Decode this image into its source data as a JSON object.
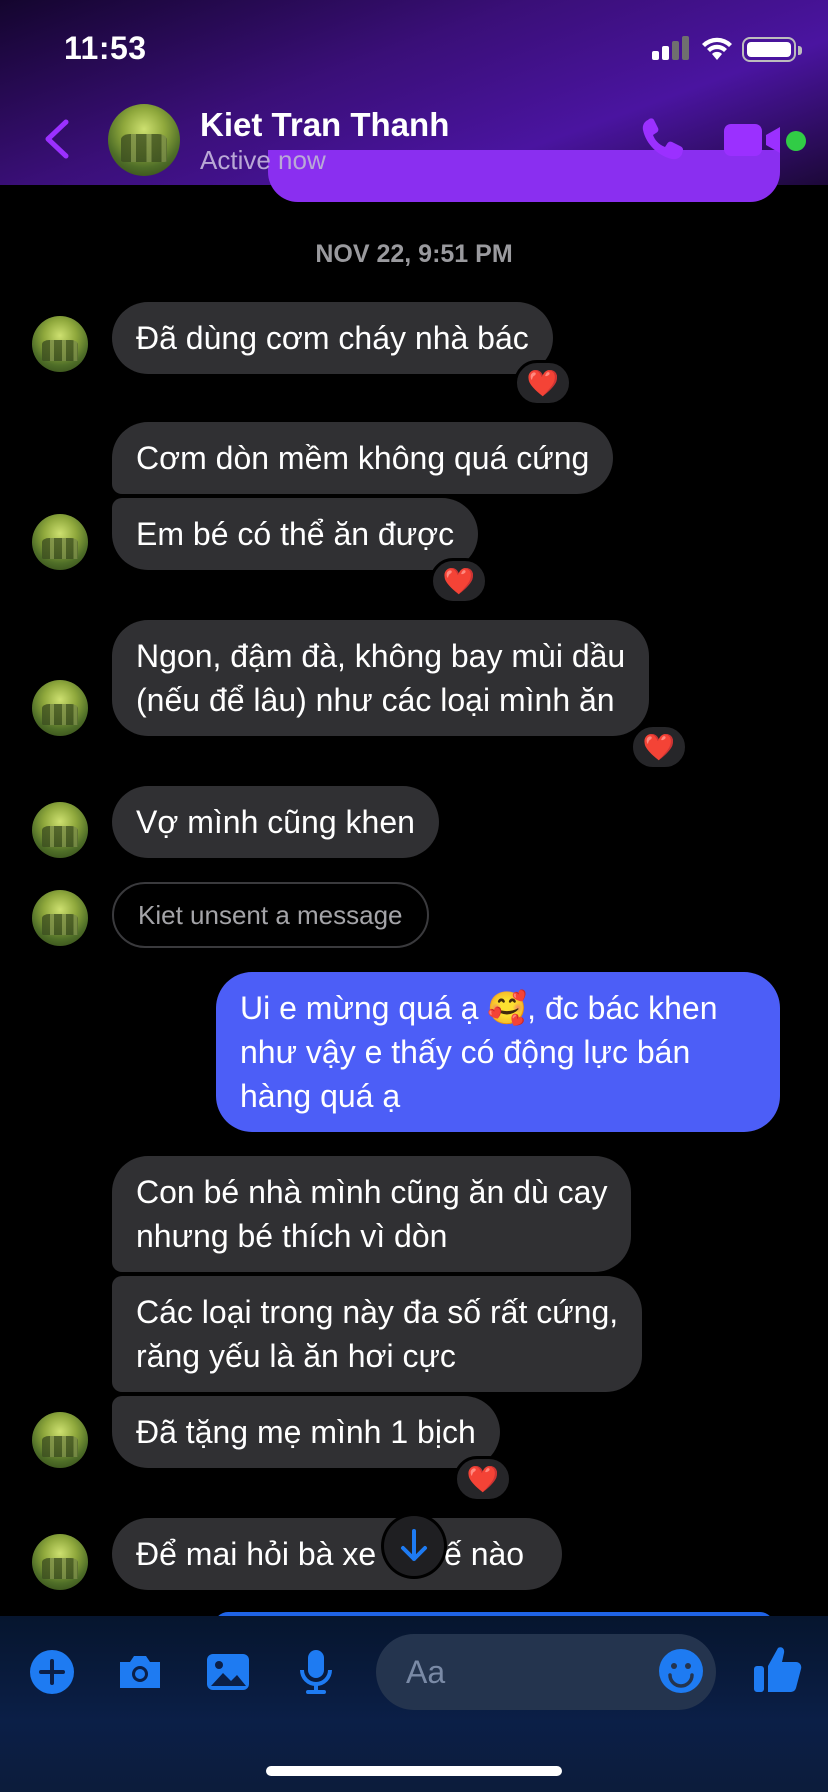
{
  "status_bar": {
    "time": "11:53"
  },
  "header": {
    "contact_name": "Kiet Tran Thanh",
    "presence": "Active now",
    "accent": "#9b30ff"
  },
  "thread": {
    "timestamp": "NOV 22, 9:51 PM",
    "messages": [
      {
        "from": "contact",
        "lines": [
          "Đã dùng cơm cháy nhà bác"
        ],
        "reaction": "❤️"
      },
      {
        "from": "contact",
        "lines": [
          "Cơm dòn mềm không quá cứng"
        ]
      },
      {
        "from": "contact",
        "lines": [
          "Em bé có thể ăn được"
        ],
        "reaction": "❤️"
      },
      {
        "from": "contact",
        "lines": [
          "Ngon, đậm đà, không bay mùi dầu",
          "(nếu để lâu) như các loại mình ăn"
        ],
        "reaction": "❤️"
      },
      {
        "from": "contact",
        "lines": [
          "Vợ mình cũng khen"
        ]
      },
      {
        "from": "contact",
        "unsent": "Kiet unsent a message"
      },
      {
        "from": "me",
        "lines": [
          "Ui e mừng quá ạ 🥰, đc bác khen",
          "như vậy e thấy có động lực bán",
          "hàng quá ạ"
        ]
      },
      {
        "from": "contact",
        "lines": [
          "Con bé nhà mình cũng ăn dù cay",
          "nhưng bé thích vì dòn"
        ]
      },
      {
        "from": "contact",
        "lines": [
          "Các loại trong này đa số rất cứng,",
          "răng yếu là ăn hơi cực"
        ]
      },
      {
        "from": "contact",
        "lines": [
          "Đã tặng mẹ mình 1 bịch"
        ],
        "reaction": "❤️"
      },
      {
        "from": "contact",
        "lines": [
          "Để mai hỏi bà xe",
          "ế nào"
        ]
      }
    ]
  },
  "composer": {
    "placeholder": "Aa",
    "icons": [
      "plus-icon",
      "camera-icon",
      "image-icon",
      "microphone-icon",
      "emoji-icon",
      "thumbs-up-icon"
    ],
    "accent": "#1e7bf2"
  }
}
